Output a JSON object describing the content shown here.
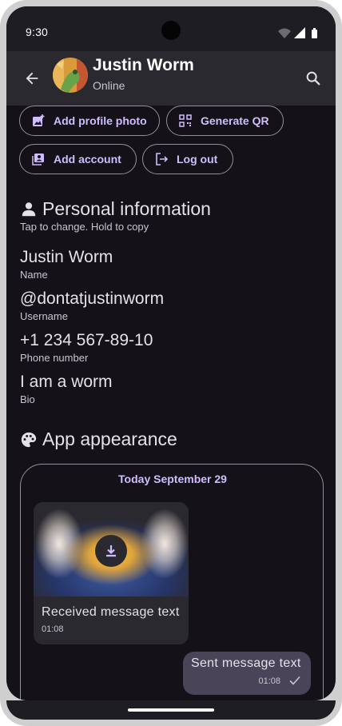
{
  "status_bar": {
    "time": "9:30"
  },
  "app_bar": {
    "title": "Justin Worm",
    "subtitle": "Online"
  },
  "chips": {
    "add_photo": "Add profile photo",
    "generate_qr": "Generate QR",
    "add_account": "Add account",
    "log_out": "Log out"
  },
  "personal": {
    "title": "Personal information",
    "hint": "Tap to change. Hold to copy",
    "fields": [
      {
        "value": "Justin Worm",
        "label": "Name"
      },
      {
        "value": "@dontatjustinworm",
        "label": "Username"
      },
      {
        "value": "+1 234 567-89-10",
        "label": "Phone number"
      },
      {
        "value": "I am a worm",
        "label": "Bio"
      }
    ]
  },
  "appearance": {
    "title": "App appearance",
    "date": "Today September 29",
    "received": {
      "text": "Received message text",
      "time": "01:08"
    },
    "sent": {
      "text": "Sent message text",
      "time": "01:08"
    }
  },
  "colors": {
    "background": "#141218",
    "app_bar": "#2b2930",
    "accent": "#d0bcff",
    "sent_bubble": "#4a4458"
  }
}
